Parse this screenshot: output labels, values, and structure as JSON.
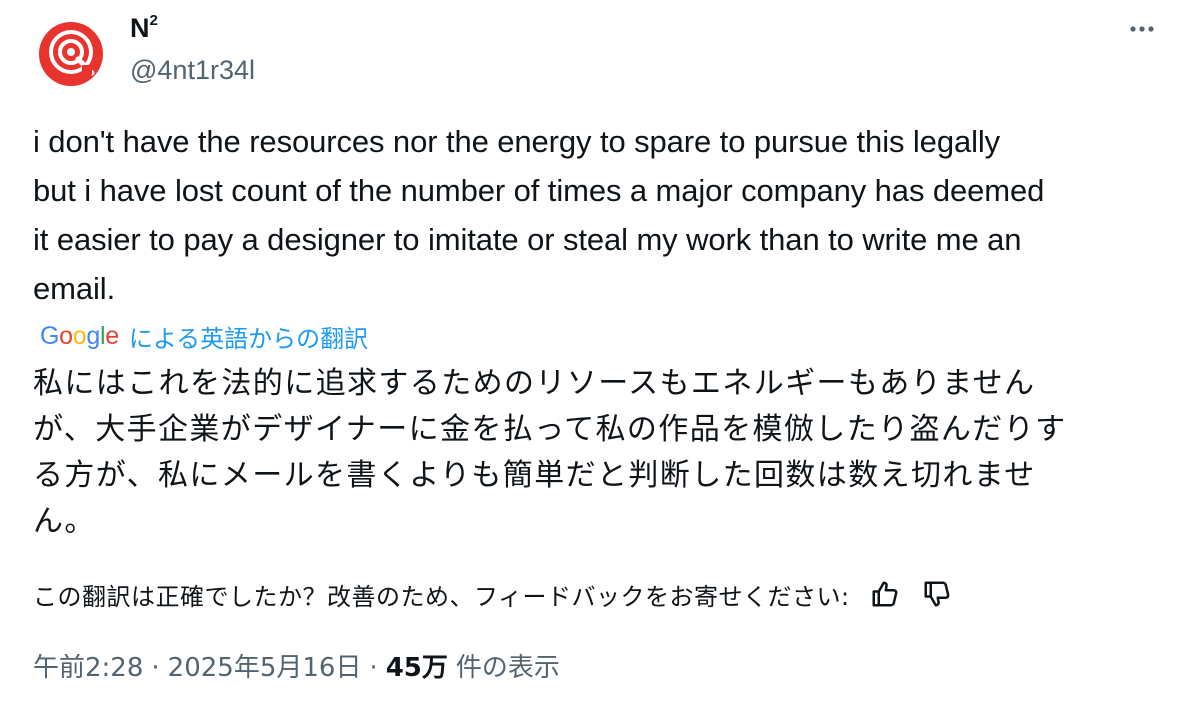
{
  "author": {
    "display_name": "N",
    "display_name_sup": "2",
    "handle": "@4nt1r34l",
    "avatar_icon": "target-logo-icon",
    "brand_color": "#e8332e"
  },
  "more_icon": "more-dots-icon",
  "tweet": {
    "text_lines": [
      "i don't have the resources nor the energy to spare to pursue this legally",
      "but i have lost count of the number of times a major company has deemed",
      "it easier to pay a designer to imitate or steal my work than to write me an",
      "email."
    ]
  },
  "translation": {
    "google_letters": [
      "G",
      "o",
      "o",
      "g",
      "l",
      "e"
    ],
    "google_colors": [
      "#4285f4",
      "#ea4335",
      "#fbbc05",
      "#4285f4",
      "#34a853",
      "#ea4335"
    ],
    "label": "による英語からの翻訳",
    "text_lines": [
      "私にはこれを法的に追求するためのリソースもエネルギーもありません",
      "が、大手企業がデザイナーに金を払って私の作品を模倣したり盗んだりす",
      "る方が、私にメールを書くよりも簡単だと判断した回数は数え切れませ",
      "ん。"
    ],
    "feedback_prompt": "この翻訳は正確でしたか？改善のため、フィードバックをお寄せください:",
    "thumbs_up_icon": "thumbs-up-icon",
    "thumbs_down_icon": "thumbs-down-icon"
  },
  "meta": {
    "time": "午前2:28",
    "separator": "·",
    "date": "2025年5月16日",
    "views_count": "45万",
    "views_label": "件の表示"
  }
}
